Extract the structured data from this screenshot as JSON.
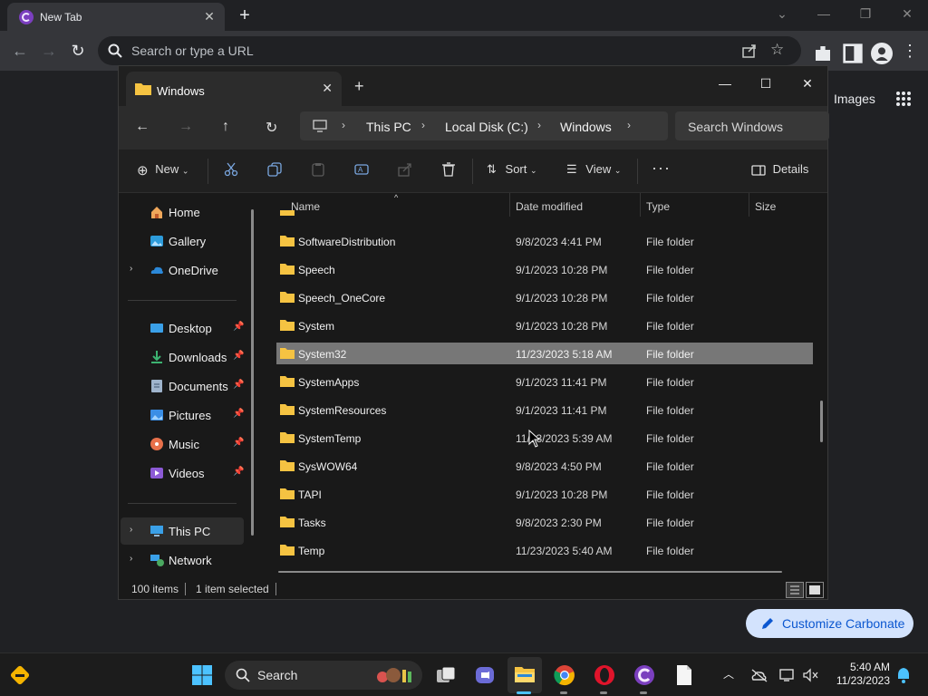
{
  "browser": {
    "tab_title": "New Tab",
    "omnibox_placeholder": "Search or type a URL",
    "ntp_images_link": "Images",
    "customize_button": "Customize Carbonate"
  },
  "explorer": {
    "tab_title": "Windows",
    "breadcrumbs": [
      "This PC",
      "Local Disk (C:)",
      "Windows"
    ],
    "search_placeholder": "Search Windows",
    "commands": {
      "new": "New",
      "sort": "Sort",
      "view": "View",
      "details": "Details"
    },
    "sidebar": {
      "top": [
        {
          "label": "Home",
          "icon": "home-icon"
        },
        {
          "label": "Gallery",
          "icon": "gallery-icon"
        },
        {
          "label": "OneDrive",
          "icon": "onedrive-icon"
        }
      ],
      "pinned": [
        {
          "label": "Desktop",
          "icon": "desktop-icon"
        },
        {
          "label": "Downloads",
          "icon": "downloads-icon"
        },
        {
          "label": "Documents",
          "icon": "documents-icon"
        },
        {
          "label": "Pictures",
          "icon": "pictures-icon"
        },
        {
          "label": "Music",
          "icon": "music-icon"
        },
        {
          "label": "Videos",
          "icon": "videos-icon"
        }
      ],
      "devices": [
        {
          "label": "This PC",
          "icon": "this-pc-icon"
        },
        {
          "label": "Network",
          "icon": "network-icon"
        }
      ]
    },
    "columns": [
      "Name",
      "Date modified",
      "Type",
      "Size"
    ],
    "rows": [
      {
        "name": "SoftwareDistribution",
        "date": "9/8/2023 4:41 PM",
        "type": "File folder"
      },
      {
        "name": "Speech",
        "date": "9/1/2023 10:28 PM",
        "type": "File folder"
      },
      {
        "name": "Speech_OneCore",
        "date": "9/1/2023 10:28 PM",
        "type": "File folder"
      },
      {
        "name": "System",
        "date": "9/1/2023 10:28 PM",
        "type": "File folder"
      },
      {
        "name": "System32",
        "date": "11/23/2023 5:18 AM",
        "type": "File folder",
        "selected": true
      },
      {
        "name": "SystemApps",
        "date": "9/1/2023 11:41 PM",
        "type": "File folder"
      },
      {
        "name": "SystemResources",
        "date": "9/1/2023 11:41 PM",
        "type": "File folder"
      },
      {
        "name": "SystemTemp",
        "date": "11/23/2023 5:39 AM",
        "type": "File folder"
      },
      {
        "name": "SysWOW64",
        "date": "9/8/2023 4:50 PM",
        "type": "File folder"
      },
      {
        "name": "TAPI",
        "date": "9/1/2023 10:28 PM",
        "type": "File folder"
      },
      {
        "name": "Tasks",
        "date": "9/8/2023 2:30 PM",
        "type": "File folder"
      },
      {
        "name": "Temp",
        "date": "11/23/2023 5:40 AM",
        "type": "File folder"
      }
    ],
    "status": {
      "item_count": "100 items",
      "selection": "1 item selected"
    }
  },
  "taskbar": {
    "search_label": "Search",
    "time": "5:40 AM",
    "date": "11/23/2023"
  },
  "colors": {
    "folder": "#f5c342",
    "selection": "#777777",
    "accent": "#0b57d0"
  }
}
